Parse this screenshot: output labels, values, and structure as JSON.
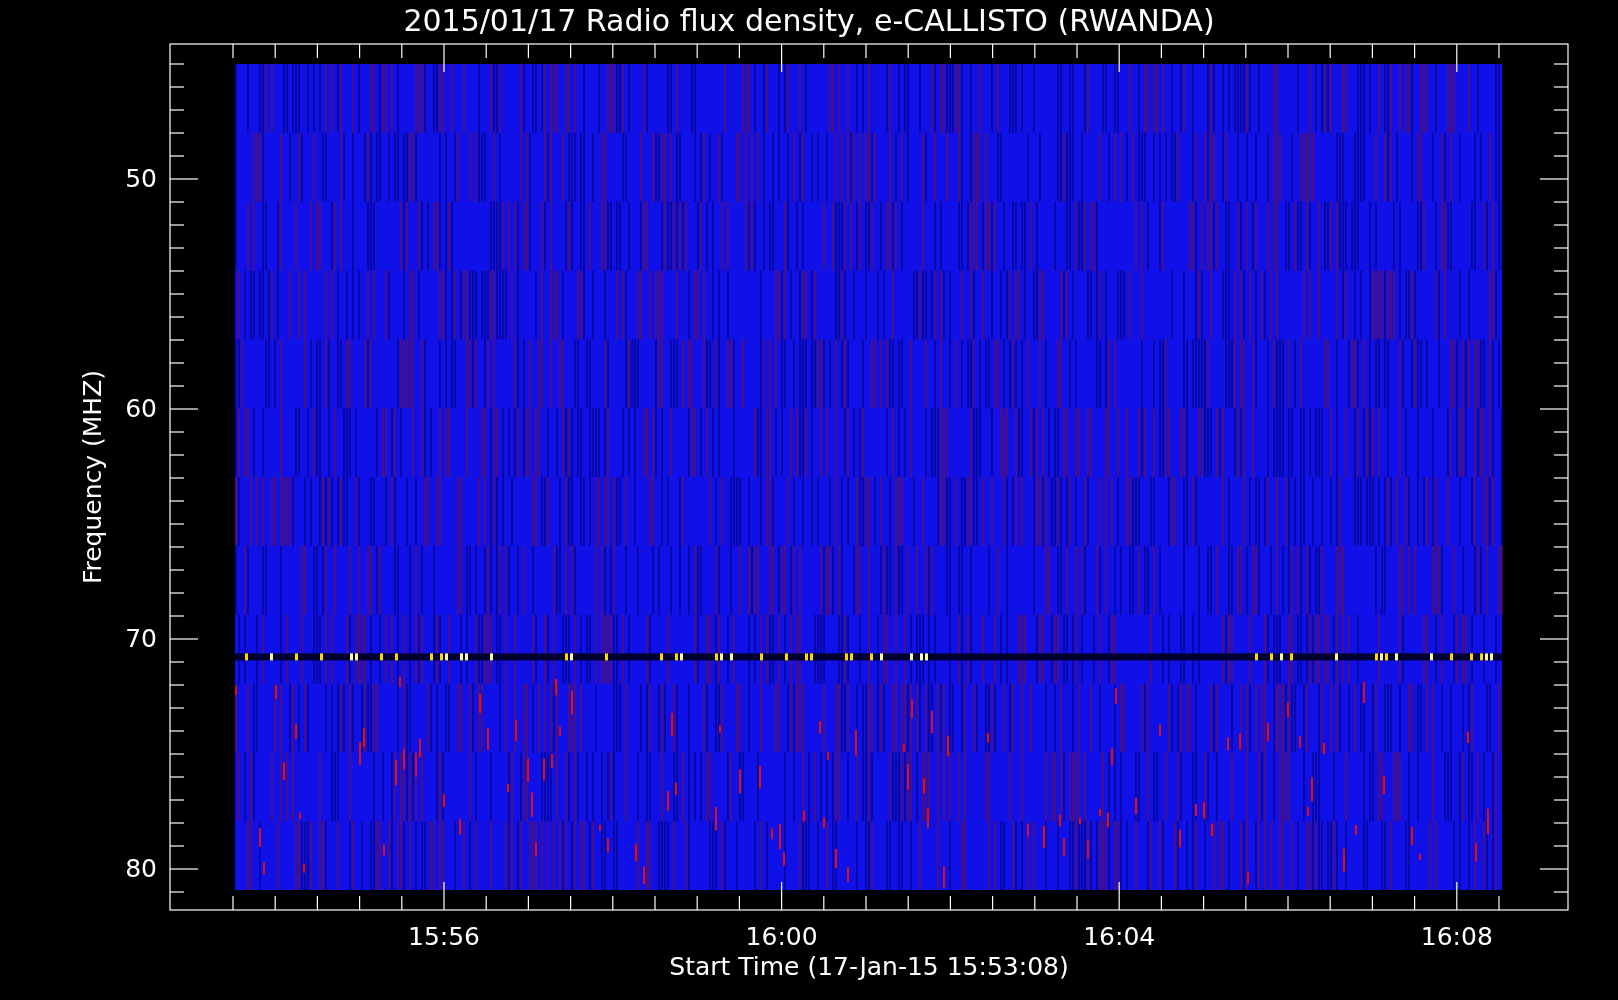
{
  "title": "2015/01/17  Radio flux density, e-CALLISTO (RWANDA)",
  "y_axis": {
    "label": "Frequency (MHZ)",
    "ticks": [
      "50",
      "60",
      "70",
      "80"
    ]
  },
  "x_axis": {
    "label": "Start Time (17-Jan-15 15:53:08)",
    "ticks": [
      "15:56",
      "16:00",
      "16:04",
      "16:08"
    ]
  }
}
